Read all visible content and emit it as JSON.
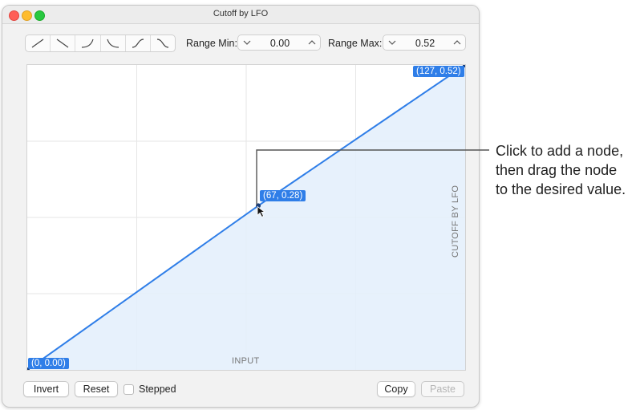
{
  "window": {
    "title": "Cutoff by LFO"
  },
  "toolbar": {
    "curve_shapes": [
      "linear-rise-icon",
      "linear-fall-icon",
      "exp-rise-icon",
      "exp-fall-icon",
      "s-curve-rise-icon",
      "s-curve-fall-icon"
    ],
    "range_min": {
      "label": "Range Min:",
      "value": "0.00"
    },
    "range_max": {
      "label": "Range Max:",
      "value": "0.52"
    }
  },
  "graph": {
    "x_axis_label": "INPUT",
    "y_axis_label": "CUTOFF BY LFO",
    "accent_color": "#2f7ee8",
    "fill_color": "#e3eefc",
    "nodes": [
      {
        "input": 0,
        "value": 0.0,
        "label": "(0, 0.00)"
      },
      {
        "input": 67,
        "value": 0.28,
        "label": "(67, 0.28)"
      },
      {
        "input": 127,
        "value": 0.52,
        "label": "(127, 0.52)"
      }
    ],
    "x_range": [
      0,
      127
    ],
    "y_range": [
      0,
      0.52
    ]
  },
  "footer": {
    "invert_label": "Invert",
    "reset_label": "Reset",
    "stepped_label": "Stepped",
    "stepped_checked": false,
    "copy_label": "Copy",
    "paste_label": "Paste"
  },
  "callout": {
    "lines": [
      "Click to add a node,",
      "then drag the node",
      "to the desired value."
    ]
  }
}
